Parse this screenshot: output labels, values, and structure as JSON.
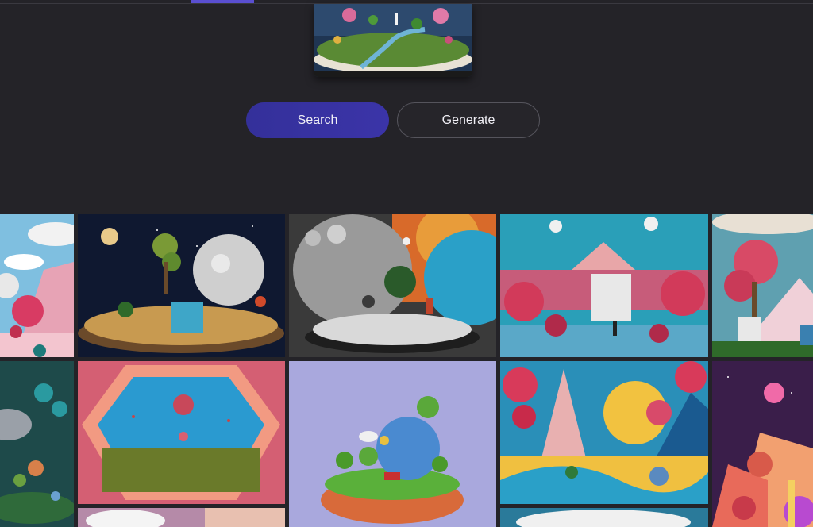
{
  "actions": {
    "search_label": "Search",
    "generate_label": "Generate"
  },
  "colors": {
    "background": "#242328",
    "accent": "#3b34a8",
    "tab_indicator": "#5a4fd1"
  },
  "gallery": {
    "images": [
      {
        "name": "pink-cloud-mountain-scene"
      },
      {
        "name": "moon-island-diorama"
      },
      {
        "name": "monochrome-mushroom-diorama"
      },
      {
        "name": "pink-waterfall-landscape"
      },
      {
        "name": "pink-tree-statue-scene"
      },
      {
        "name": "teal-mushroom-garden"
      },
      {
        "name": "hexagon-frame-landscape"
      },
      {
        "name": "floating-lowpoly-island"
      },
      {
        "name": "sun-mountain-coral-scene"
      },
      {
        "name": "purple-sky-fantasy-forest"
      },
      {
        "name": "cloud-sky-partial"
      },
      {
        "name": "white-cloud-partial"
      }
    ]
  }
}
